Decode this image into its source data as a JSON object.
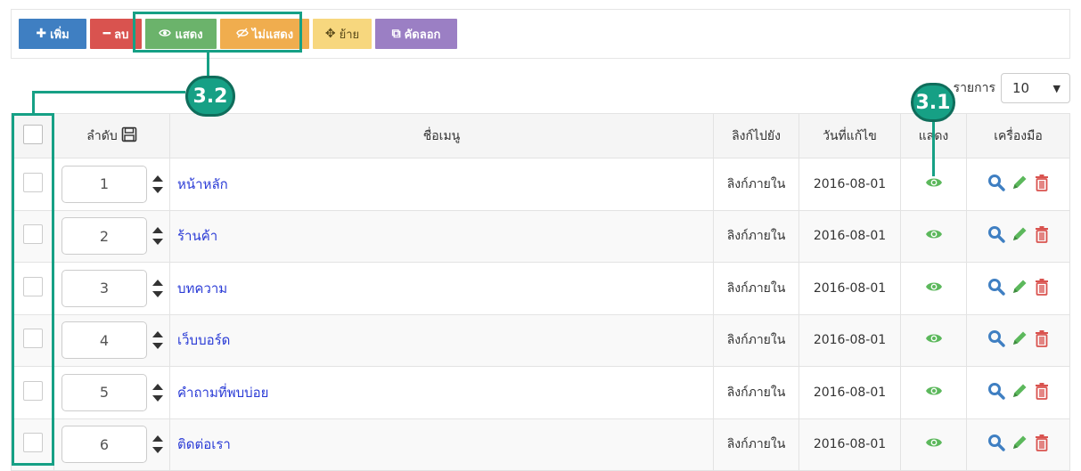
{
  "toolbar": {
    "add": "เพิ่ม",
    "delete": "ลบ",
    "show": "แสดง",
    "hide": "ไม่แสดง",
    "move": "ย้าย",
    "copy": "คัดลอก"
  },
  "callouts": {
    "buttons": "3.2",
    "show_column": "3.1"
  },
  "per_page": {
    "label": "รายการ",
    "value": "10"
  },
  "table": {
    "headers": {
      "order": "ลำดับ",
      "name": "ชื่อเมนู",
      "link": "ลิงก์ไปยัง",
      "date": "วันที่แก้ไข",
      "show": "แสดง",
      "tools": "เครื่องมือ"
    },
    "rows": [
      {
        "order": "1",
        "name": "หน้าหลัก",
        "link": "ลิงก์ภายใน",
        "date": "2016-08-01"
      },
      {
        "order": "2",
        "name": "ร้านค้า",
        "link": "ลิงก์ภายใน",
        "date": "2016-08-01"
      },
      {
        "order": "3",
        "name": "บทความ",
        "link": "ลิงก์ภายใน",
        "date": "2016-08-01"
      },
      {
        "order": "4",
        "name": "เว็บบอร์ด",
        "link": "ลิงก์ภายใน",
        "date": "2016-08-01"
      },
      {
        "order": "5",
        "name": "คำถามที่พบบ่อย",
        "link": "ลิงก์ภายใน",
        "date": "2016-08-01"
      },
      {
        "order": "6",
        "name": "ติดต่อเรา",
        "link": "ลิงก์ภายใน",
        "date": "2016-08-01"
      }
    ]
  },
  "icons": {
    "add": "plus-icon",
    "delete": "minus-icon",
    "show": "eye-icon",
    "hide": "eye-slash-icon",
    "move": "move-icon",
    "copy": "copy-icon",
    "save": "save-icon",
    "view": "search-icon",
    "edit": "pencil-icon",
    "trash": "trash-icon"
  },
  "colors": {
    "primary": "#3f7fc2",
    "danger": "#d9534f",
    "success": "#6bb36b",
    "warning": "#f0ad4e",
    "move": "#f7d77e",
    "copy": "#9b7fc4",
    "callout": "#16a085",
    "link": "#2a3bd6",
    "eye": "#5cb85c",
    "search": "#3f7fc2",
    "edit": "#5cb85c",
    "trash": "#d9534f"
  }
}
